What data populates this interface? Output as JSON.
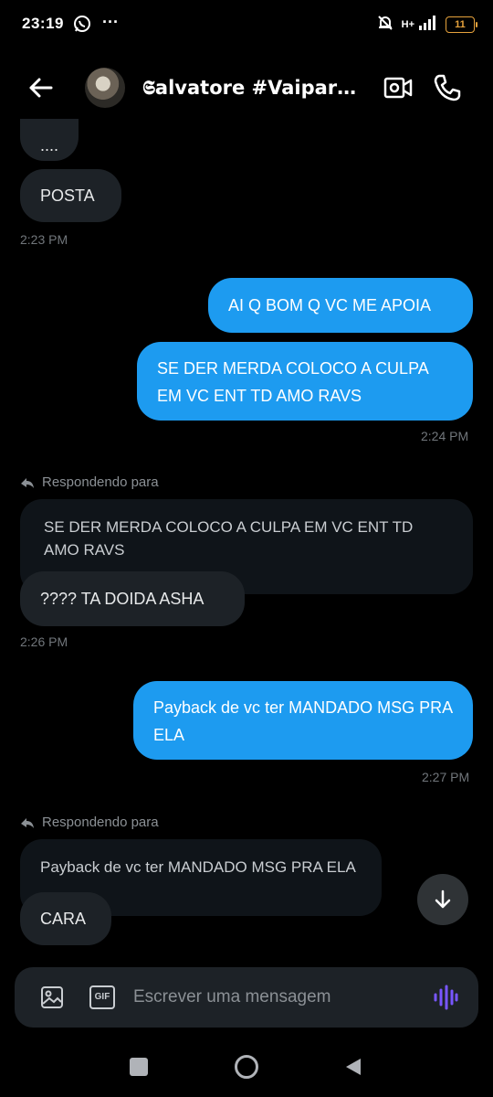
{
  "status_bar": {
    "time": "23:19",
    "network": "H+",
    "battery": "11"
  },
  "header": {
    "contact_name": "𝕾alvatore #Vaiparao…"
  },
  "messages": [
    {
      "text": "....",
      "side": "in"
    },
    {
      "text": "POSTA",
      "side": "in",
      "time": "2:23 PM"
    },
    {
      "text": "AI Q BOM Q VC ME APOIA",
      "side": "out"
    },
    {
      "text": "SE DER MERDA COLOCO A CULPA EM VC ENT TD AMO RAVS",
      "side": "out",
      "time": "2:24 PM"
    },
    {
      "reply_label": "Respondendo para",
      "quote": "SE DER MERDA COLOCO A CULPA EM VC ENT TD AMO RAVS",
      "text": "???? TA DOIDA ASHA",
      "side": "in",
      "time": "2:26 PM"
    },
    {
      "text": "Payback de vc ter MANDADO MSG PRA ELA",
      "side": "out",
      "time": "2:27 PM"
    },
    {
      "reply_label": "Respondendo para",
      "quote": "Payback de vc ter MANDADO MSG PRA ELA",
      "text": "CARA",
      "side": "in"
    }
  ],
  "composer": {
    "placeholder": "Escrever uma mensagem",
    "gif_label": "GIF"
  },
  "colors": {
    "accent": "#1d9bf0",
    "incoming_bubble": "#1d2227",
    "voice_icon": "#7856ff"
  }
}
